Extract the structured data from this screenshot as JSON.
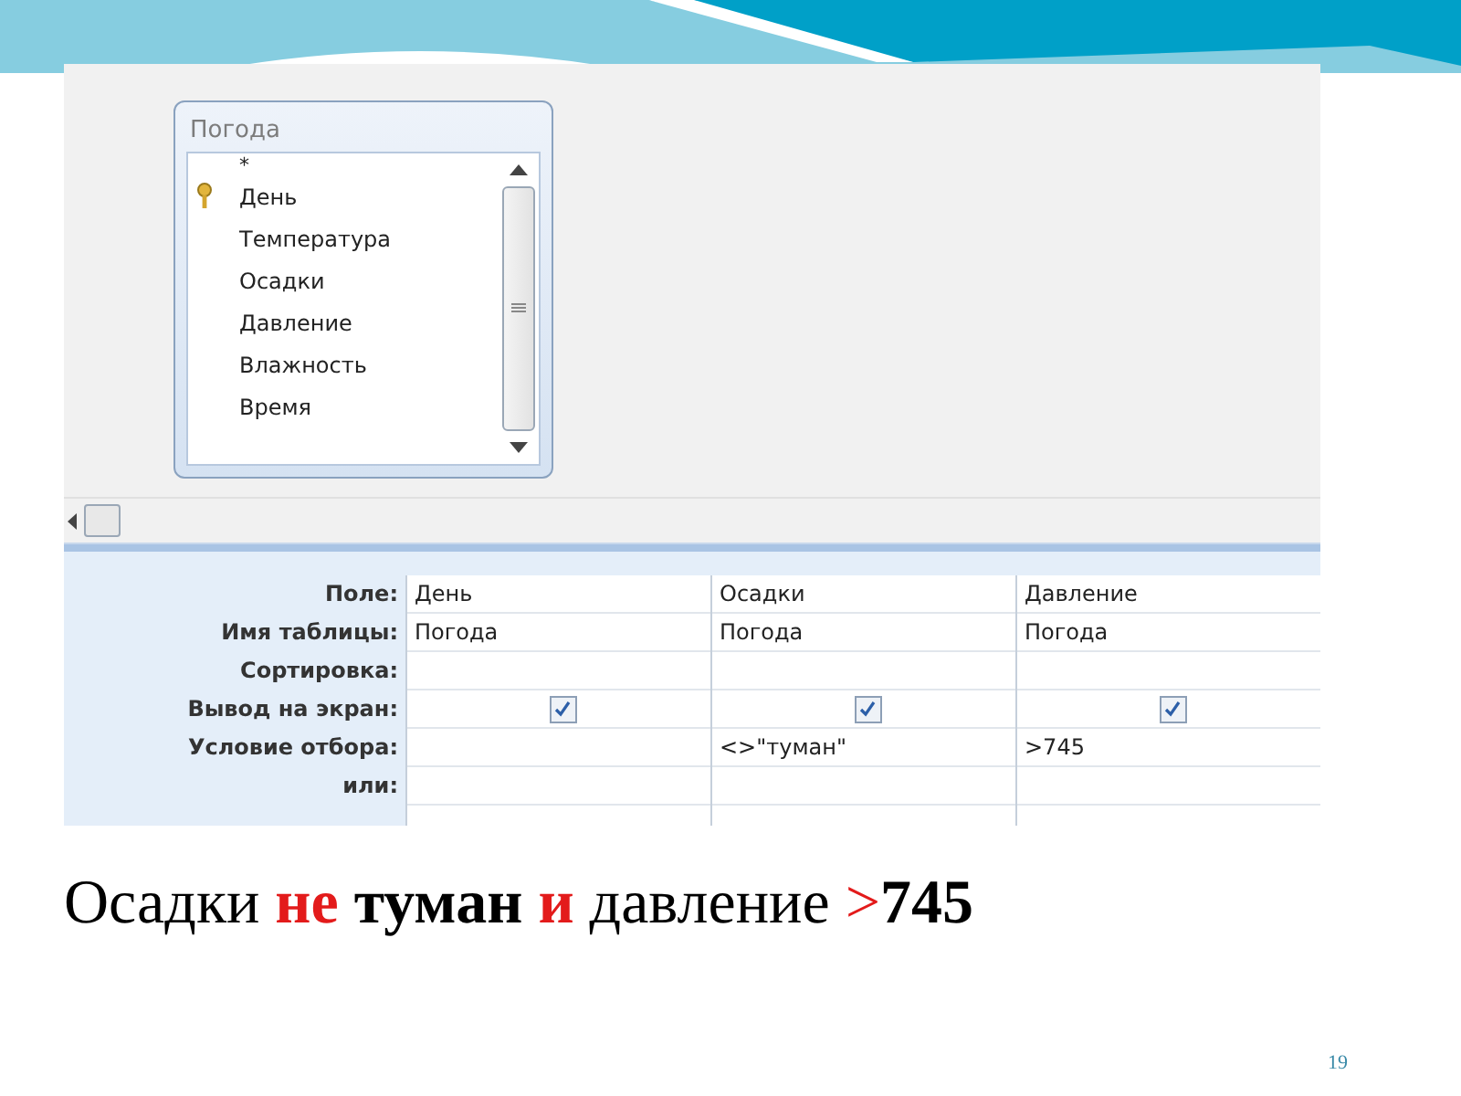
{
  "table_box": {
    "title": "Погода",
    "fields": [
      {
        "name": "*",
        "key": false
      },
      {
        "name": "День",
        "key": true
      },
      {
        "name": "Температура",
        "key": false
      },
      {
        "name": "Осадки",
        "key": false
      },
      {
        "name": "Давление",
        "key": false
      },
      {
        "name": "Влажность",
        "key": false
      },
      {
        "name": "Время",
        "key": false
      }
    ]
  },
  "grid": {
    "row_labels": [
      "Поле:",
      "Имя таблицы:",
      "Сортировка:",
      "Вывод на экран:",
      "Условие отбора:",
      "или:"
    ],
    "columns": [
      {
        "field": "День",
        "table": "Погода",
        "show": true
      },
      {
        "field": "Осадки",
        "table": "Погода",
        "show": true,
        "criteria": "<>\"туман\""
      },
      {
        "field": "Давление",
        "table": "Погода",
        "show": true,
        "criteria": ">745"
      }
    ]
  },
  "caption": {
    "parts": [
      {
        "text": "Осадки ",
        "bold": false,
        "color": "#000000"
      },
      {
        "text": "не ",
        "bold": true,
        "color": "#e31b1b"
      },
      {
        "text": "туман ",
        "bold": true,
        "color": "#000000"
      },
      {
        "text": "и ",
        "bold": true,
        "color": "#e31b1b"
      },
      {
        "text": "давление ",
        "bold": false,
        "color": "#000000"
      },
      {
        "text": ">",
        "bold": false,
        "color": "#e31b1b"
      },
      {
        "text": "745",
        "bold": true,
        "color": "#000000"
      }
    ]
  },
  "page_number": "19"
}
